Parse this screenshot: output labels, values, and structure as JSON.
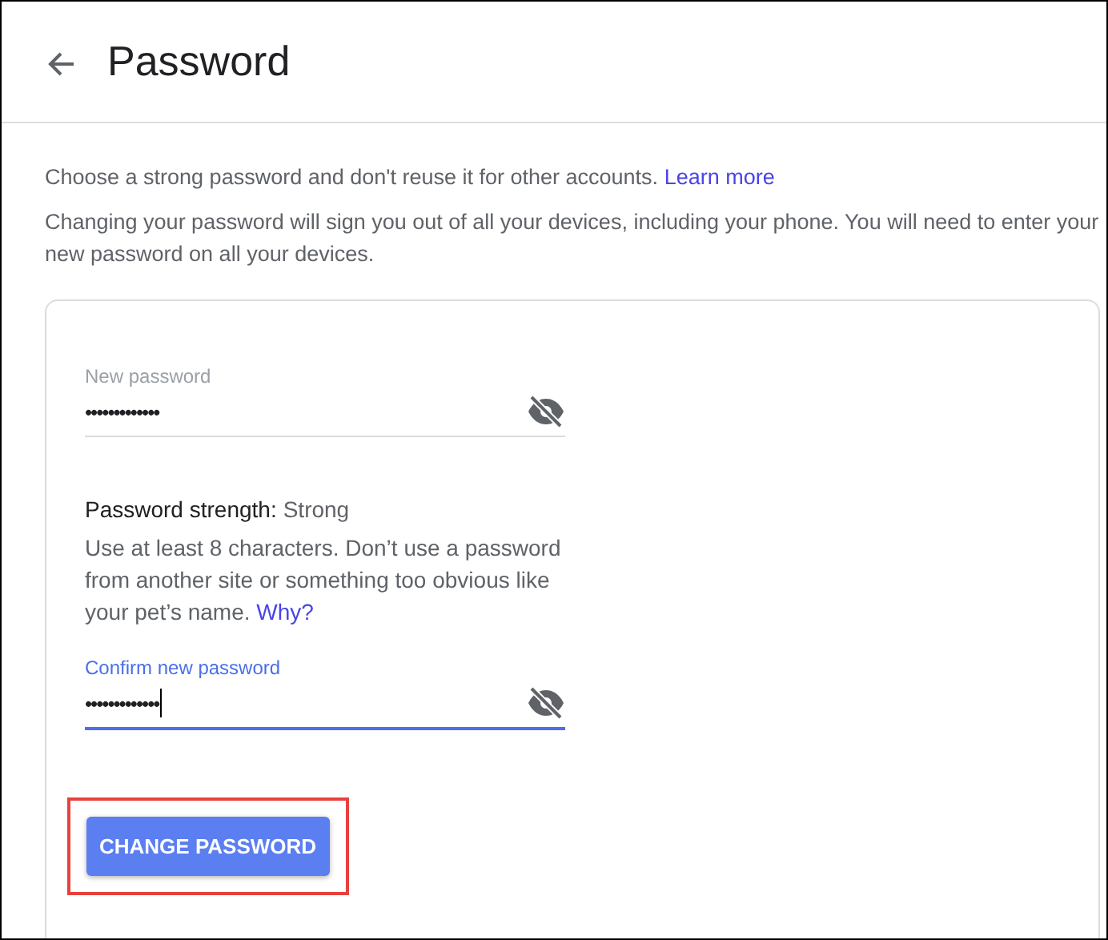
{
  "header": {
    "title": "Password"
  },
  "intro": {
    "text": "Choose a strong password and don't reuse it for other accounts.",
    "link": "Learn more"
  },
  "notice": "Changing your password will sign you out of all your devices, including your phone. You will need to enter your new password on all your devices.",
  "new_password": {
    "label": "New password",
    "value": "•••••••••••••",
    "focused": false
  },
  "strength": {
    "label": "Password strength:",
    "value": "Strong"
  },
  "hint": {
    "text": "Use at least 8 characters. Don’t use a password from another site or something too obvious like your pet’s name.",
    "link": "Why?"
  },
  "confirm_password": {
    "label": "Confirm new password",
    "value": "•••••••••••••",
    "focused": true
  },
  "submit": {
    "label": "CHANGE PASSWORD",
    "highlighted": true
  }
}
